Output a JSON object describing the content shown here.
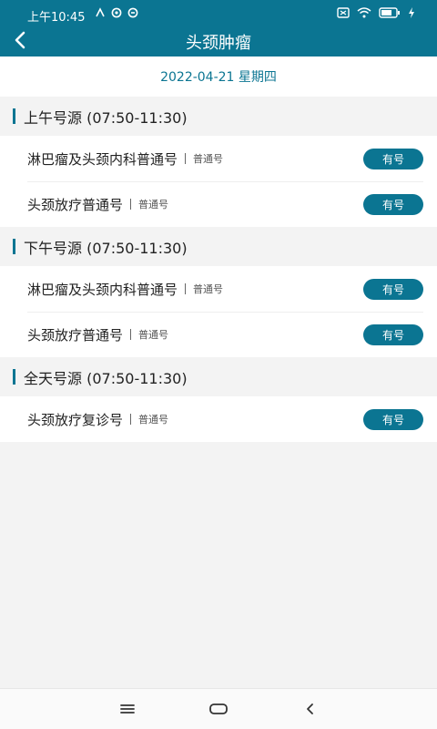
{
  "status": {
    "time": "上午10:45"
  },
  "header": {
    "title": "头颈肿瘤"
  },
  "date": "2022-04-21 星期四",
  "sections": [
    {
      "title": "上午号源 (07:50-11:30)",
      "rows": [
        {
          "name": "淋巴瘤及头颈内科普通号",
          "type": "普通号",
          "status": "有号"
        },
        {
          "name": "头颈放疗普通号",
          "type": "普通号",
          "status": "有号"
        }
      ]
    },
    {
      "title": "下午号源 (07:50-11:30)",
      "rows": [
        {
          "name": "淋巴瘤及头颈内科普通号",
          "type": "普通号",
          "status": "有号"
        },
        {
          "name": "头颈放疗普通号",
          "type": "普通号",
          "status": "有号"
        }
      ]
    },
    {
      "title": "全天号源 (07:50-11:30)",
      "rows": [
        {
          "name": "头颈放疗复诊号",
          "type": "普通号",
          "status": "有号"
        }
      ]
    }
  ],
  "icons": {
    "back": "back-chevron-icon",
    "nav_menu": "menu-icon",
    "nav_home": "home-icon",
    "nav_back": "back-icon"
  },
  "colors": {
    "primary": "#0b7592",
    "background": "#f3f3f3"
  }
}
